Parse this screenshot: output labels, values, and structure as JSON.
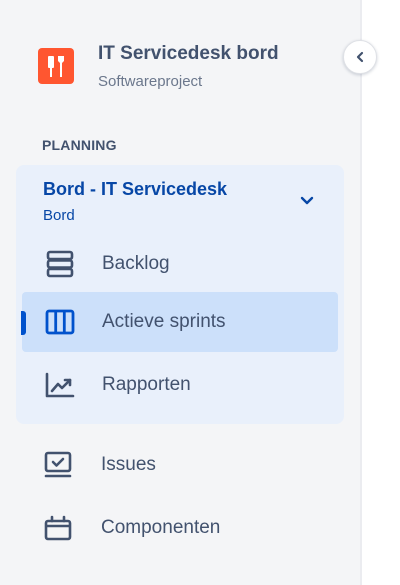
{
  "project": {
    "name": "IT Servicedesk bord",
    "type": "Softwareproject",
    "avatar_color": "#ff5630"
  },
  "section": {
    "heading": "PLANNING"
  },
  "board": {
    "title": "Bord - IT Servicedesk",
    "subtitle": "Bord",
    "expanded": true,
    "items": [
      {
        "label": "Backlog",
        "icon": "backlog-icon",
        "active": false
      },
      {
        "label": "Actieve sprints",
        "icon": "columns-icon",
        "active": true
      },
      {
        "label": "Rapporten",
        "icon": "chart-line-icon",
        "active": false
      }
    ]
  },
  "nav": {
    "items": [
      {
        "label": "Issues",
        "icon": "issues-icon"
      },
      {
        "label": "Componenten",
        "icon": "components-icon"
      }
    ]
  },
  "colors": {
    "accent": "#0052cc",
    "board_text": "#0747a6",
    "active_bg": "#cce0fa",
    "group_bg": "#e9f0fb",
    "sidebar_bg": "#f4f5f7",
    "text": "#42526e"
  }
}
